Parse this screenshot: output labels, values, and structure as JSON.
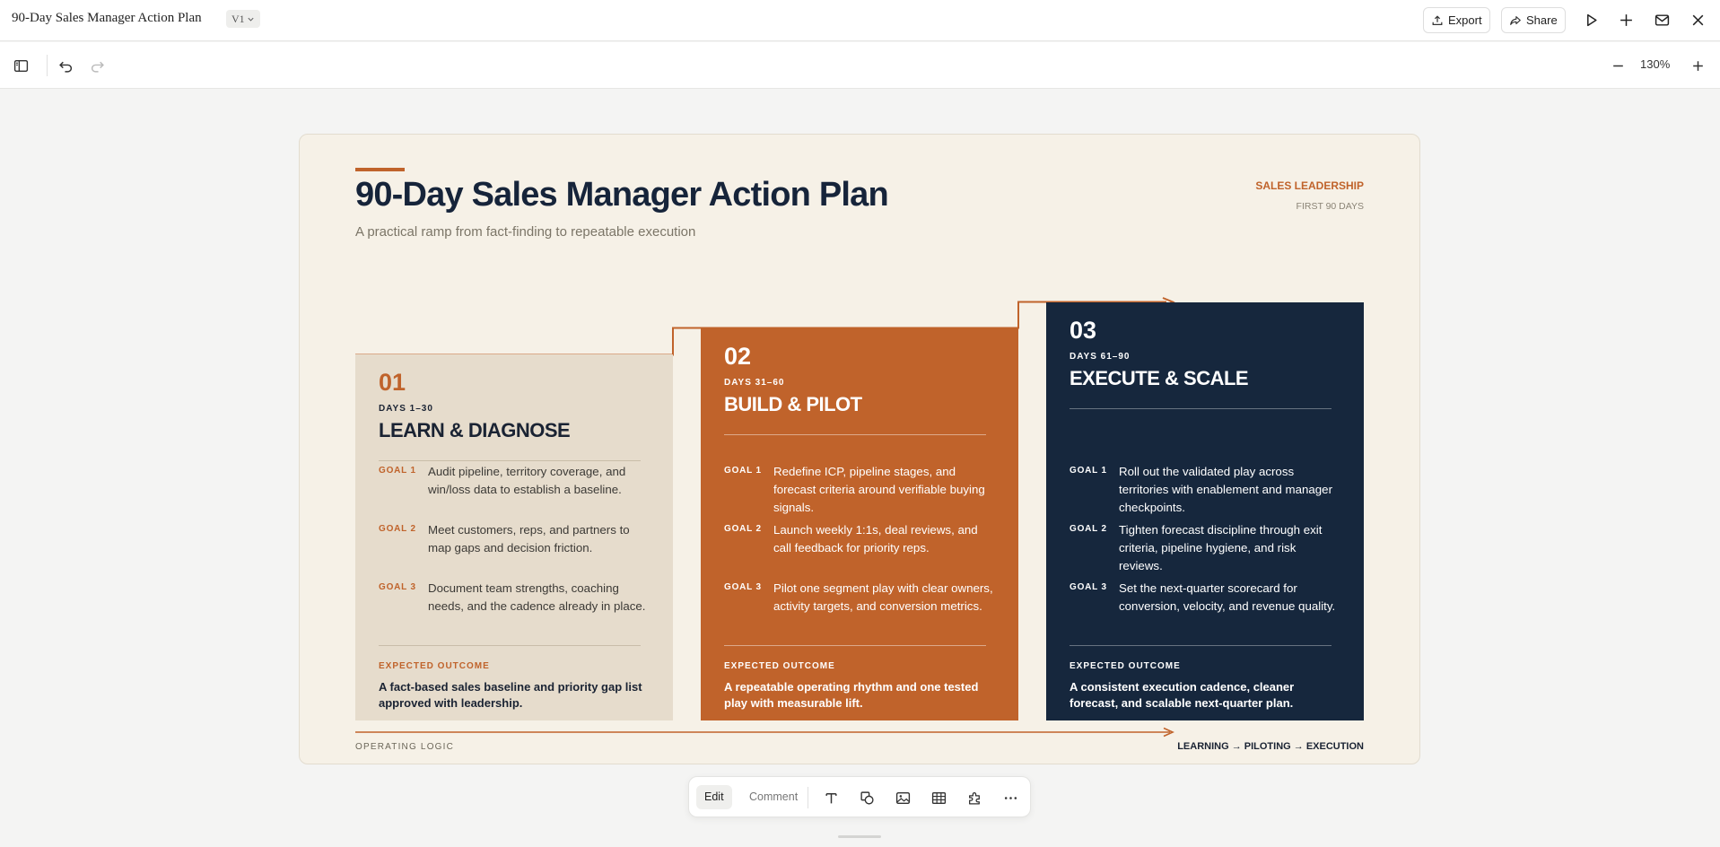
{
  "app": {
    "doc_title": "90-Day Sales Manager Action Plan",
    "version": "V1",
    "export_label": "Export",
    "share_label": "Share",
    "zoom": "130%"
  },
  "slide": {
    "title": "90-Day Sales Manager Action Plan",
    "subtitle": "A practical ramp from fact-finding to repeatable execution",
    "corner_label": "SALES LEADERSHIP",
    "corner_sub": "FIRST 90 DAYS",
    "footer_left": "OPERATING LOGIC",
    "footer_right": "LEARNING → PILOTING → EXECUTION",
    "phases": [
      {
        "num": "01",
        "days": "DAYS 1–30",
        "title": "LEARN & DIAGNOSE",
        "goals": [
          {
            "label": "GOAL 1",
            "text": "Audit pipeline, territory coverage, and win/loss data to establish a baseline."
          },
          {
            "label": "GOAL 2",
            "text": "Meet customers, reps, and partners to map gaps and decision friction."
          },
          {
            "label": "GOAL 3",
            "text": "Document team strengths, coaching needs, and the cadence already in place."
          }
        ],
        "outcome_label": "EXPECTED OUTCOME",
        "outcome": "A fact-based sales baseline and priority gap list approved with leadership."
      },
      {
        "num": "02",
        "days": "DAYS 31–60",
        "title": "BUILD & PILOT",
        "goals": [
          {
            "label": "GOAL 1",
            "text": "Redefine ICP, pipeline stages, and forecast criteria around verifiable buying signals."
          },
          {
            "label": "GOAL 2",
            "text": "Launch weekly 1:1s, deal reviews, and call feedback for priority reps."
          },
          {
            "label": "GOAL 3",
            "text": "Pilot one segment play with clear owners, activity targets, and conversion metrics."
          }
        ],
        "outcome_label": "EXPECTED OUTCOME",
        "outcome": "A repeatable operating rhythm and one tested play with measurable lift."
      },
      {
        "num": "03",
        "days": "DAYS 61–90",
        "title": "EXECUTE & SCALE",
        "goals": [
          {
            "label": "GOAL 1",
            "text": "Roll out the validated play across territories with enablement and manager checkpoints."
          },
          {
            "label": "GOAL 2",
            "text": "Tighten forecast discipline through exit criteria, pipeline hygiene, and risk reviews."
          },
          {
            "label": "GOAL 3",
            "text": "Set the next-quarter scorecard for conversion, velocity, and revenue quality."
          }
        ],
        "outcome_label": "EXPECTED OUTCOME",
        "outcome": "A consistent execution cadence, cleaner forecast, and scalable next-quarter plan."
      }
    ]
  },
  "bottom_toolbar": {
    "edit_label": "Edit",
    "comment_label": "Comment"
  },
  "colors": {
    "accent": "#c0632b",
    "navy": "#16273d",
    "slide_bg": "#f6f1e7",
    "card1_bg": "#e6dccc"
  }
}
